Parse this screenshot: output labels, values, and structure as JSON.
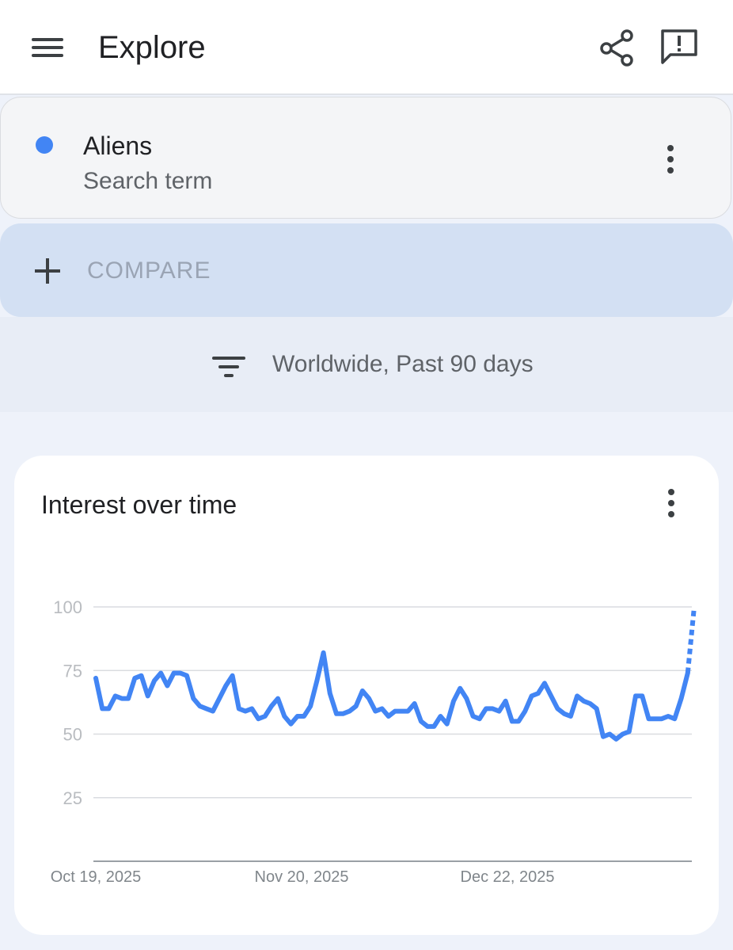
{
  "header": {
    "title": "Explore",
    "icons": [
      "menu-icon",
      "share-icon",
      "feedback-icon"
    ]
  },
  "search_term": {
    "name": "Aliens",
    "type": "Search term",
    "color": "#4285f4"
  },
  "compare": {
    "label": "COMPARE"
  },
  "filter": {
    "text": "Worldwide, Past 90 days"
  },
  "chart_card": {
    "title": "Interest over time"
  },
  "chart_data": {
    "type": "line",
    "title": "Interest over time",
    "ylim": [
      0,
      100
    ],
    "yticks": [
      "100",
      "75",
      "50",
      "25"
    ],
    "xticks": [
      "Oct 19, 2025",
      "Nov 20, 2025",
      "Dec 22, 2025"
    ],
    "x_start": "Oct 19, 2025",
    "x_end": "Jan 16, 2026",
    "grid": true,
    "series": [
      {
        "color": "#4285f4",
        "values": [
          72,
          60,
          60,
          65,
          64,
          64,
          72,
          73,
          65,
          71,
          74,
          69,
          74,
          74,
          73,
          64,
          61,
          60,
          59,
          64,
          69,
          73,
          60,
          59,
          60,
          56,
          57,
          61,
          64,
          57,
          54,
          57,
          57,
          61,
          71,
          82,
          66,
          58,
          58,
          59,
          61,
          67,
          64,
          59,
          60,
          57,
          59,
          59,
          59,
          62,
          55,
          53,
          53,
          57,
          54,
          63,
          68,
          64,
          57,
          56,
          60,
          60,
          59,
          63,
          55,
          55,
          59,
          65,
          66,
          70,
          65,
          60,
          58,
          57,
          65,
          63,
          62,
          60,
          49,
          50,
          48,
          50,
          51,
          65,
          65,
          56,
          56,
          56,
          57,
          56,
          64,
          74
        ],
        "partial_values": [
          74,
          100
        ]
      }
    ]
  }
}
